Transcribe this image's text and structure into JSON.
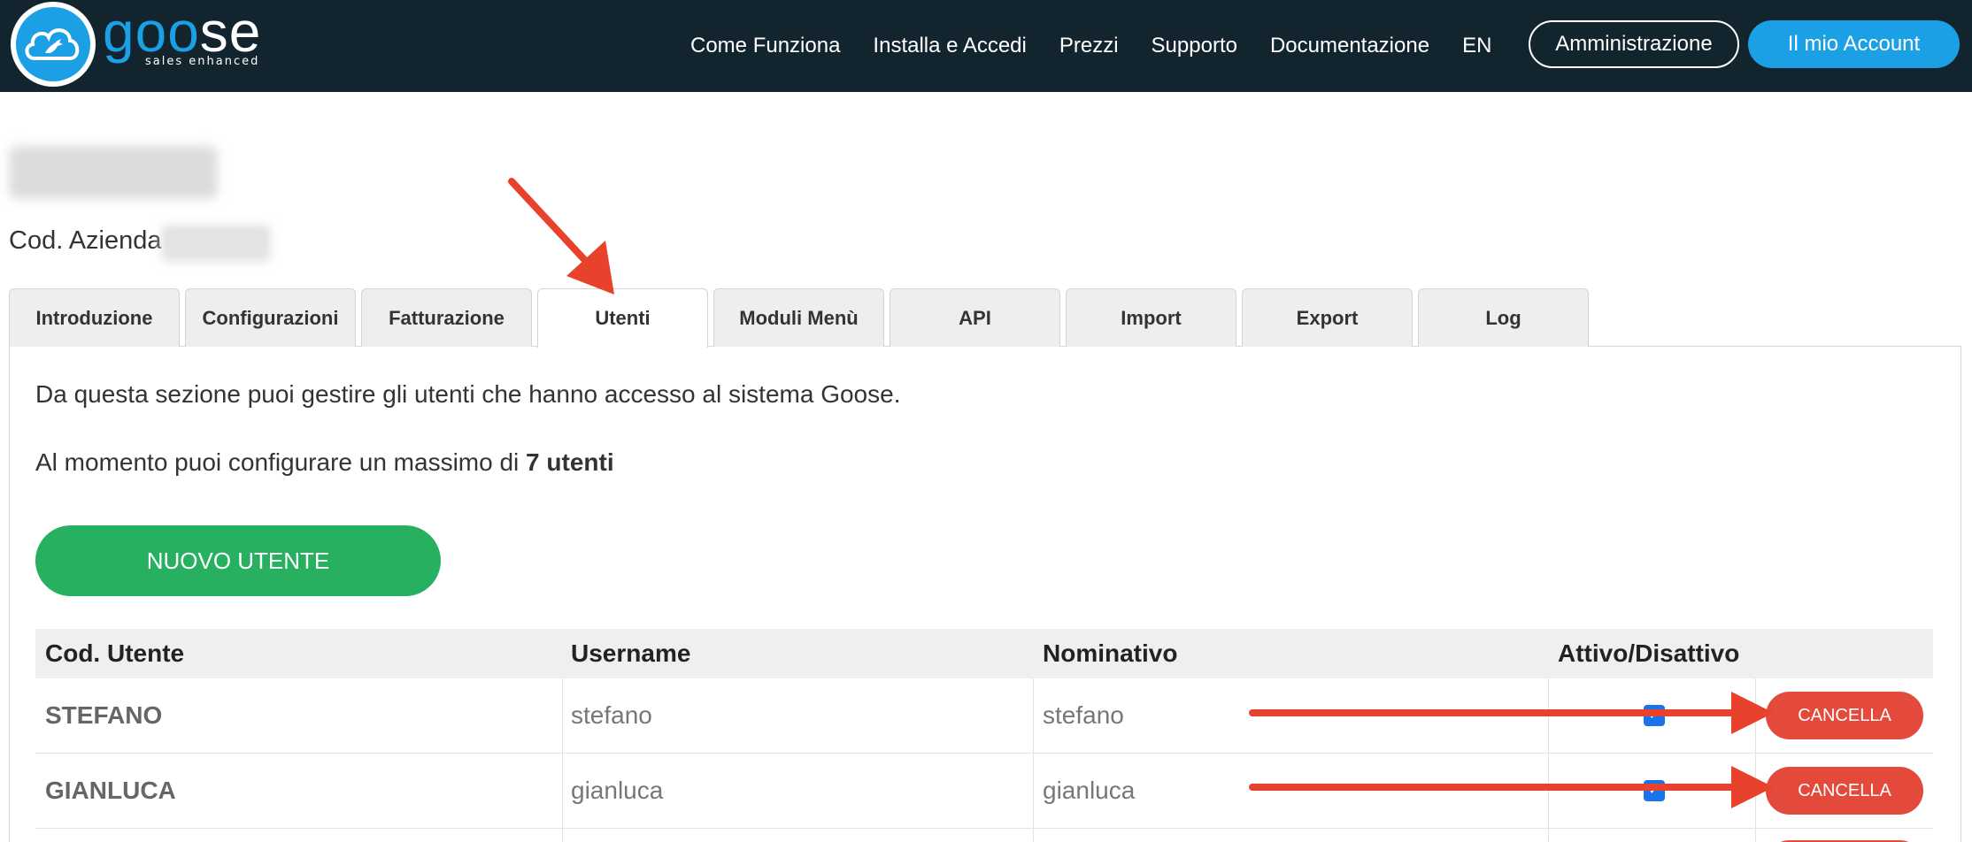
{
  "brand": {
    "word_part1": "goo",
    "word_part2": "se",
    "tagline": "sales enhanced"
  },
  "nav": {
    "links": [
      "Come Funziona",
      "Installa e Accedi",
      "Prezzi",
      "Supporto",
      "Documentazione",
      "EN"
    ],
    "admin_label": "Amministrazione",
    "account_label": "Il mio Account"
  },
  "company": {
    "code_label": "Cod. Azienda"
  },
  "tabs": [
    {
      "label": "Introduzione"
    },
    {
      "label": "Configurazioni"
    },
    {
      "label": "Fatturazione"
    },
    {
      "label": "Utenti",
      "active": true
    },
    {
      "label": "Moduli Menù"
    },
    {
      "label": "API"
    },
    {
      "label": "Import"
    },
    {
      "label": "Export"
    },
    {
      "label": "Log"
    }
  ],
  "content": {
    "intro": "Da questa sezione puoi gestire gli utenti che hanno accesso al sistema Goose.",
    "limit_prefix": "Al momento puoi configurare un massimo di",
    "limit_value": "7 utenti",
    "new_user_label": "NUOVO UTENTE"
  },
  "table": {
    "headers": [
      "Cod. Utente",
      "Username",
      "Nominativo",
      "Attivo/Disattivo"
    ],
    "rows": [
      {
        "code": "STEFANO",
        "username": "stefano",
        "name": "stefano",
        "active": true,
        "delete_label": "CANCELLA"
      },
      {
        "code": "GIANLUCA",
        "username": "gianluca",
        "name": "gianluca",
        "active": true,
        "delete_label": "CANCELLA"
      }
    ]
  },
  "colors": {
    "navbar": "#12252f",
    "accent_blue": "#1ba0e6",
    "new_button_green": "#27b060",
    "delete_red": "#e44a3c",
    "annotation_arrow": "#e8412c"
  }
}
